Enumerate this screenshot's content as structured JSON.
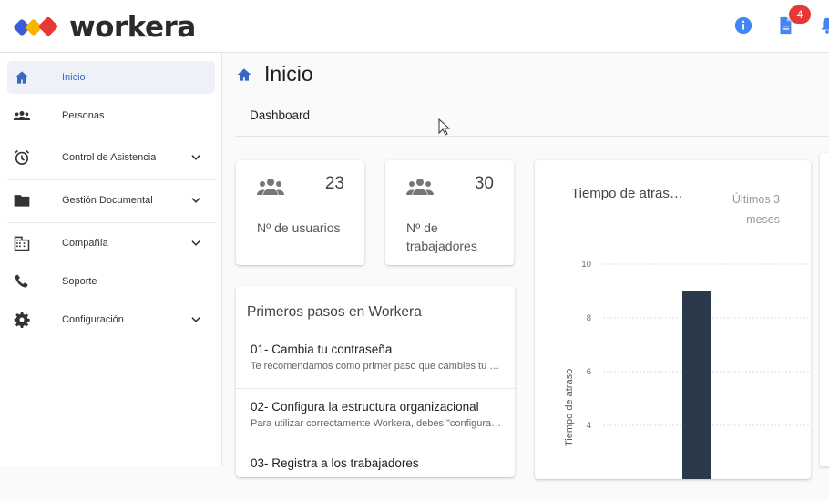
{
  "app": {
    "brand_name": "workera",
    "brand_colors": [
      "#3b5bdb",
      "#f7b500",
      "#e53935"
    ],
    "notifications_count": "4"
  },
  "topbar": {
    "icons": [
      "info-icon",
      "document-icon",
      "bell-icon"
    ],
    "accent": "#4285f4"
  },
  "sidebar": {
    "items": [
      {
        "label": "Inicio",
        "icon": "home-icon",
        "active": true
      },
      {
        "label": "Personas",
        "icon": "people-icon"
      },
      {
        "label": "Control de Asistencia",
        "icon": "alarm-clock-icon",
        "expandable": true
      },
      {
        "label": "Gestión Documental",
        "icon": "folder-icon",
        "expandable": true
      },
      {
        "label": "Compañía",
        "icon": "building-icon",
        "expandable": true
      },
      {
        "label": "Soporte",
        "icon": "phone-icon"
      },
      {
        "label": "Configuración",
        "icon": "gear-icon",
        "expandable": true
      }
    ]
  },
  "page": {
    "title": "Inicio",
    "tabs": [
      "Dashboard"
    ]
  },
  "stats": [
    {
      "value": "23",
      "label": "Nº de usuarios"
    },
    {
      "value": "30",
      "label": "Nº de trabajadores"
    }
  ],
  "steps": {
    "title": "Primeros pasos en Workera",
    "items": [
      {
        "title": "01- Cambia tu contraseña",
        "desc": "Te recomendamos como primer paso que cambies tu contraseña"
      },
      {
        "title": "02- Configura la estructura organizacional",
        "desc": "Para utilizar correctamente Workera, debes \"configurar la estructura\""
      },
      {
        "title": "03- Registra a los trabajadores",
        "desc": ""
      }
    ]
  },
  "chart_data": {
    "type": "bar",
    "title": "Tiempo de atraso",
    "subtitle": "Últimos 3 meses",
    "ylabel": "Tiempo de atraso",
    "yticks": [
      4,
      6,
      8,
      10
    ],
    "ylim": [
      0,
      10
    ],
    "values": [
      9
    ],
    "bar_color": "#2b3a4a",
    "grid": true
  }
}
